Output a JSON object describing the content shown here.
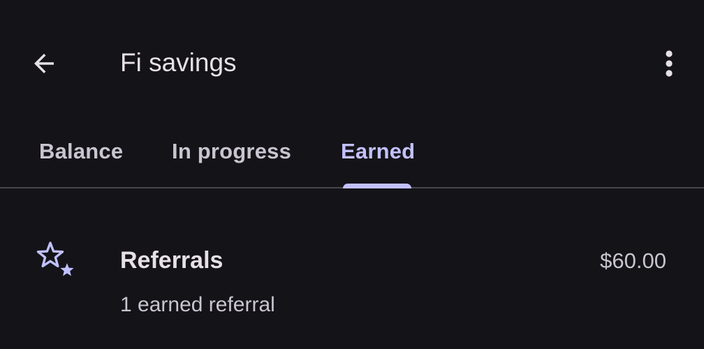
{
  "app_bar": {
    "title": "Fi savings",
    "back_icon": "arrow-back-icon",
    "more_icon": "more-vert-icon"
  },
  "tabs": [
    {
      "label": "Balance",
      "active": false
    },
    {
      "label": "In progress",
      "active": false
    },
    {
      "label": "Earned",
      "active": true
    }
  ],
  "earned_items": [
    {
      "icon": "stars-icon",
      "title": "Referrals",
      "subtitle": "1 earned referral",
      "amount": "$60.00"
    }
  ],
  "colors": {
    "background": "#141318",
    "accent": "#c2c1ff",
    "text_primary": "#e6e1e6",
    "text_secondary": "#c9c5d0",
    "divider": "#47464c"
  }
}
